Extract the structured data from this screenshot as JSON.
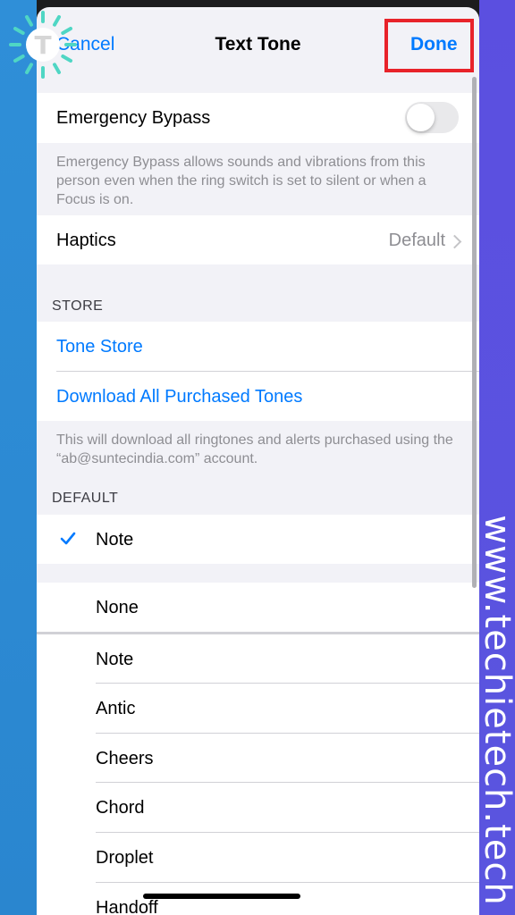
{
  "colors": {
    "accent": "#007aff",
    "highlight": "#e8232a",
    "left_strip": "#2f8fd8",
    "right_strip": "#5b4fe0"
  },
  "watermark": {
    "text": "www.techietech.tech",
    "logo_letter": "T"
  },
  "nav": {
    "cancel_label": "Cancel",
    "title": "Text Tone",
    "done_label": "Done"
  },
  "emergency": {
    "label": "Emergency Bypass",
    "enabled": false,
    "footnote": "Emergency Bypass allows sounds and vibrations from this person even when the ring switch is set to silent or when a Focus is on."
  },
  "haptics": {
    "label": "Haptics",
    "value": "Default"
  },
  "store": {
    "header": "STORE",
    "tone_store": "Tone Store",
    "download_all": "Download All Purchased Tones",
    "footnote": "This will download all ringtones and alerts purchased using the “ab@suntecindia.com” account."
  },
  "default_section": {
    "header": "DEFAULT",
    "selected": "Note"
  },
  "tones": {
    "none": "None",
    "list": [
      "Note",
      "Antic",
      "Cheers",
      "Chord",
      "Droplet",
      "Handoff"
    ]
  }
}
